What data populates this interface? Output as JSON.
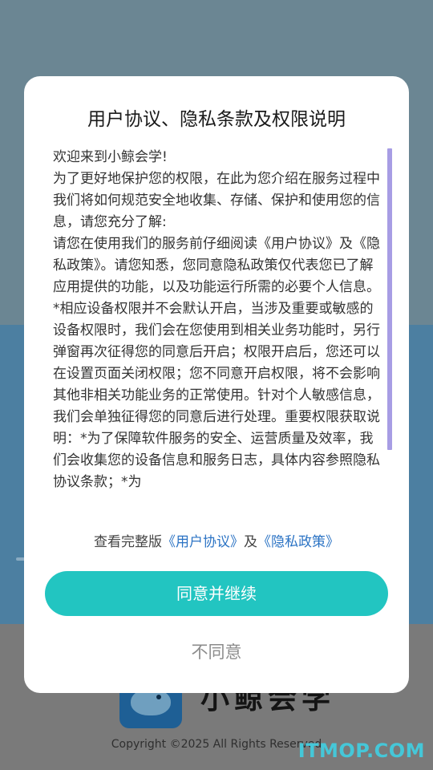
{
  "dialog": {
    "title": "用户协议、隐私条款及权限说明",
    "paragraphs": [
      "欢迎来到小鲸会学!",
      "为了更好地保护您的权限，在此为您介绍在服务过程中我们将如何规范安全地收集、存储、保护和使用您的信息，请您充分了解:",
      "请您在使用我们的服务前仔细阅读《用户协议》及《隐私政策》。请您知悉，您同意隐私政策仅代表您已了解应用提供的功能，以及功能运行所需的必要个人信息。",
      "*相应设备权限并不会默认开启，当涉及重要或敏感的设备权限时，我们会在您使用到相关业务功能时，另行弹窗再次征得您的同意后开启；权限开启后，您还可以在设置页面关闭权限；您不同意开启权限，将不会影响其他非相关功能业务的正常使用。针对个人敏感信息，我们会单独征得您的同意后进行处理。重要权限获取说明：*为了保障软件服务的安全、运营质量及效率，我们会收集您的设备信息和服务日志，具体内容参照隐私协议条款；*为"
    ],
    "links_prefix": "查看完整版",
    "user_agreement_link": "《用户协议》",
    "links_joiner": "及",
    "privacy_policy_link": "《隐私政策》",
    "agree_label": "同意并继续",
    "disagree_label": "不同意"
  },
  "background": {
    "app_name": "小鲸会学",
    "copyright": "Copyright ©2025 All Rights Reserved",
    "watermark": "ITMOP.COM"
  },
  "colors": {
    "accent": "#22c5c1",
    "link": "#2b73c4",
    "scrollbar": "#a79de4"
  }
}
